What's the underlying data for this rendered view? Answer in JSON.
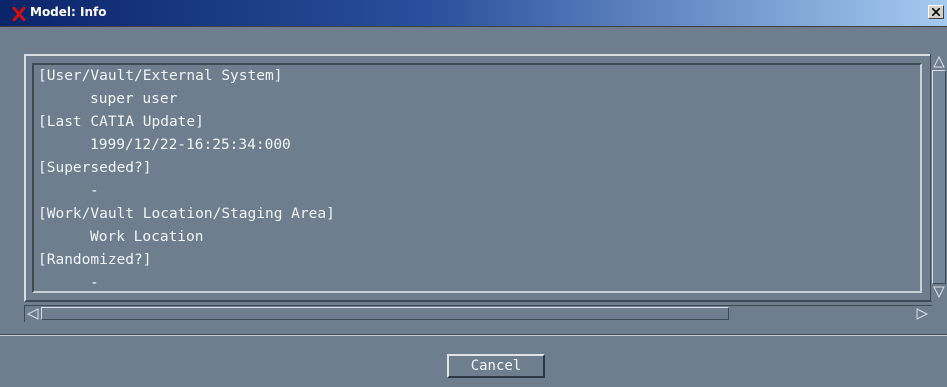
{
  "window": {
    "title": "Model: Info",
    "title_icon": "catia-x-icon",
    "close_icon": "close-icon"
  },
  "info_lines": [
    {
      "text": "[User/Vault/External System]",
      "kind": "heading"
    },
    {
      "text": "super user",
      "kind": "value"
    },
    {
      "text": "[Last CATIA Update]",
      "kind": "heading"
    },
    {
      "text": "1999/12/22-16:25:34:000",
      "kind": "value"
    },
    {
      "text": "[Superseded?]",
      "kind": "heading"
    },
    {
      "text": "-",
      "kind": "value"
    },
    {
      "text": "[Work/Vault Location/Staging Area]",
      "kind": "heading"
    },
    {
      "text": "Work Location",
      "kind": "value"
    },
    {
      "text": "[Randomized?]",
      "kind": "heading"
    },
    {
      "text": "-",
      "kind": "value"
    }
  ],
  "buttons": {
    "cancel_label": "Cancel"
  },
  "colors": {
    "title_gradient_start": "#0a246a",
    "title_gradient_end": "#a6caf0",
    "panel_background": "#6e7e8e",
    "text_color": "#f2f4f6",
    "close_x_color": "#c00000"
  }
}
